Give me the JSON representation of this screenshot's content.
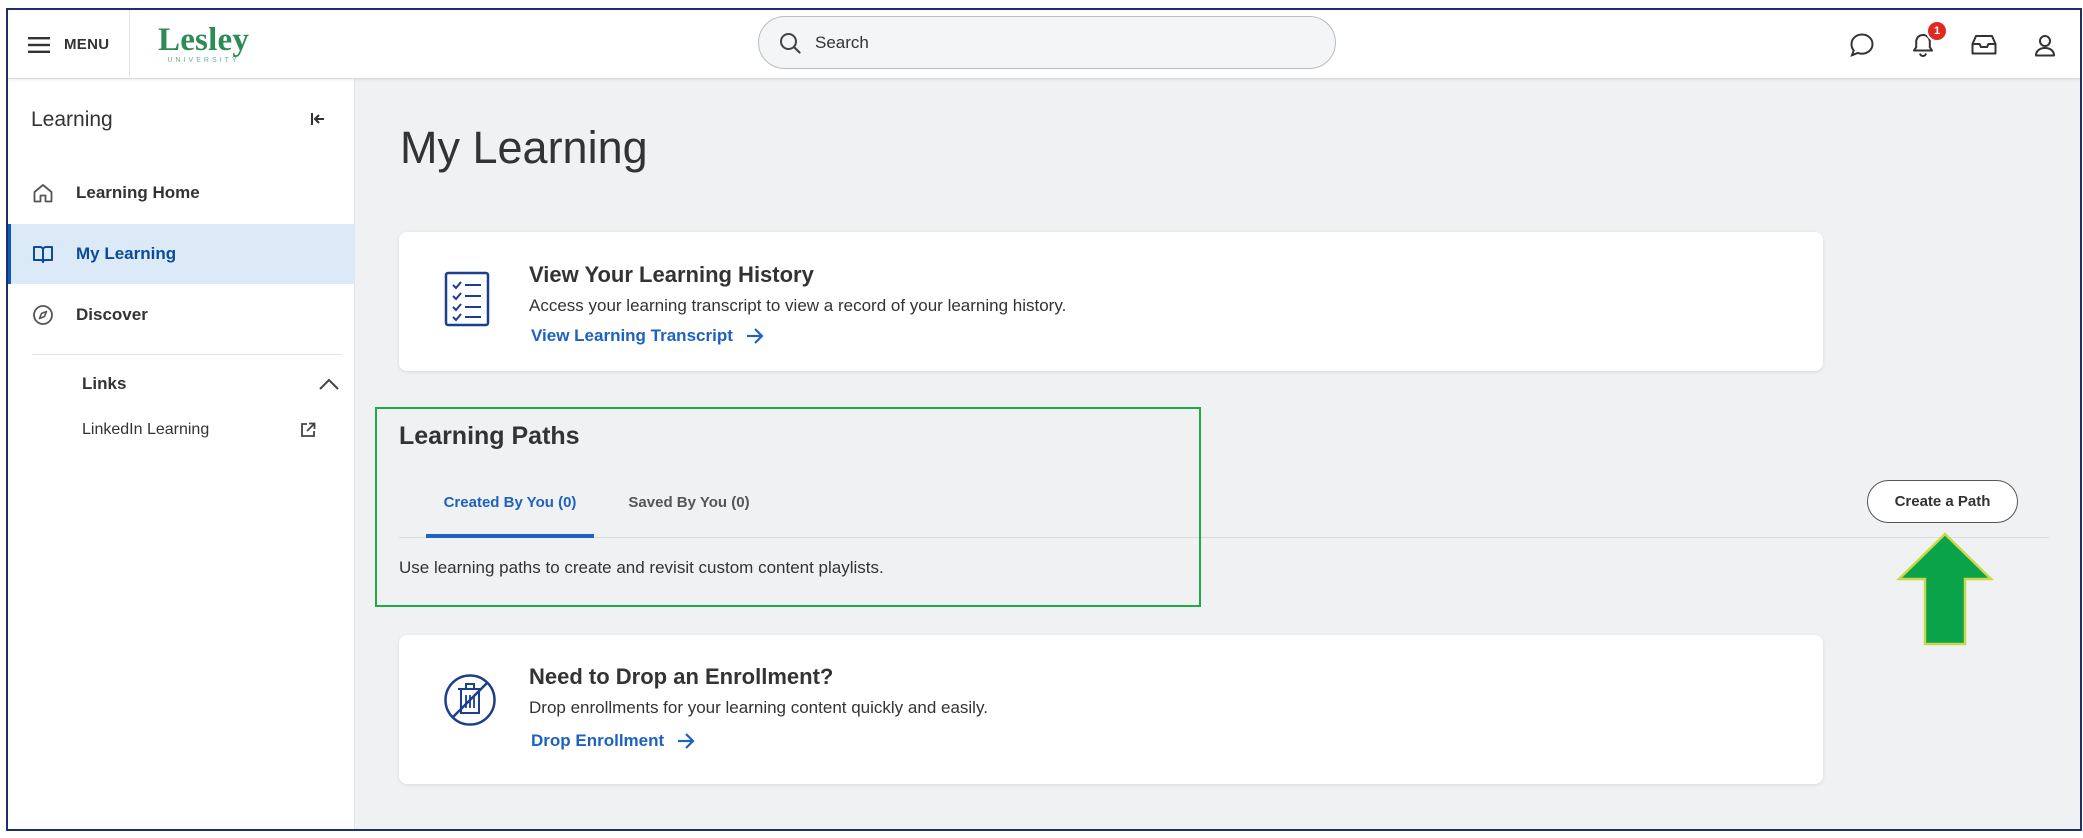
{
  "topbar": {
    "menu_label": "MENU",
    "logo_name": "Lesley",
    "logo_sub": "UNIVERSITY",
    "search_placeholder": "Search",
    "notification_count": "1",
    "icons": [
      "chat-icon",
      "bell-icon",
      "inbox-icon",
      "profile-icon"
    ]
  },
  "sidebar": {
    "title": "Learning",
    "items": [
      {
        "label": "Learning Home",
        "icon": "home-icon"
      },
      {
        "label": "My Learning",
        "icon": "book-icon",
        "active": true
      },
      {
        "label": "Discover",
        "icon": "compass-icon"
      }
    ],
    "links_label": "Links",
    "links": [
      {
        "label": "LinkedIn Learning",
        "icon": "external-link-icon"
      }
    ]
  },
  "main": {
    "page_title": "My Learning",
    "history_card": {
      "title": "View Your Learning History",
      "description": "Access your learning transcript to view a record of your learning history.",
      "link": "View Learning Transcript"
    },
    "learning_paths": {
      "title": "Learning Paths",
      "tabs": [
        {
          "label": "Created By You (0)",
          "active": true
        },
        {
          "label": "Saved By You (0)",
          "active": false
        }
      ],
      "description": "Use learning paths to create and revisit custom content playlists.",
      "create_button": "Create a Path"
    },
    "drop_card": {
      "title": "Need to Drop an Enrollment?",
      "description": "Drop enrollments for your learning content quickly and easily.",
      "link": "Drop Enrollment"
    }
  },
  "colors": {
    "accent": "#1d62c0",
    "brand": "#2e8b57",
    "highlight": "#1faa44",
    "arrow": "#0aa34a",
    "badge": "#de2a20"
  }
}
